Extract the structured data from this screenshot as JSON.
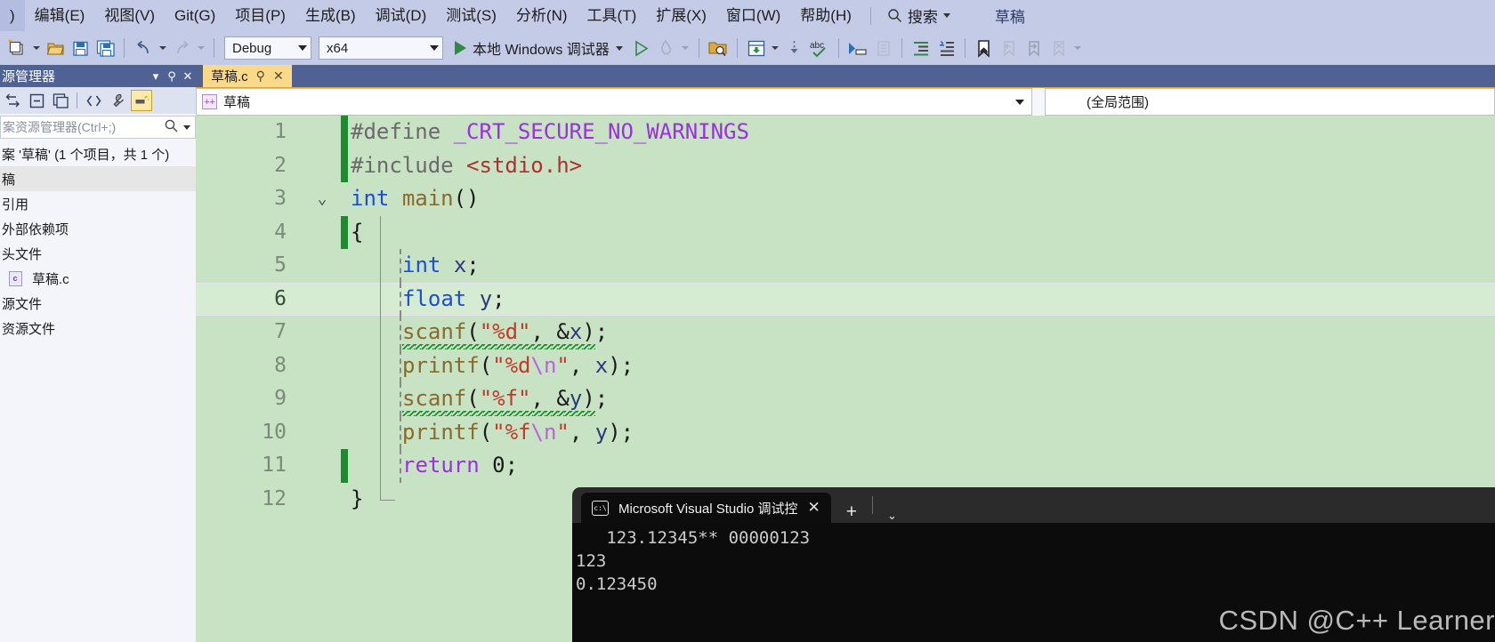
{
  "menu": {
    "items": [
      {
        "label": ")",
        "name": "menu-file-partial"
      },
      {
        "label": "编辑(E)",
        "name": "menu-edit"
      },
      {
        "label": "视图(V)",
        "name": "menu-view"
      },
      {
        "label": "Git(G)",
        "name": "menu-git"
      },
      {
        "label": "项目(P)",
        "name": "menu-project"
      },
      {
        "label": "生成(B)",
        "name": "menu-build"
      },
      {
        "label": "调试(D)",
        "name": "menu-debug"
      },
      {
        "label": "测试(S)",
        "name": "menu-test"
      },
      {
        "label": "分析(N)",
        "name": "menu-analyze"
      },
      {
        "label": "工具(T)",
        "name": "menu-tools"
      },
      {
        "label": "扩展(X)",
        "name": "menu-extensions"
      },
      {
        "label": "窗口(W)",
        "name": "menu-window"
      },
      {
        "label": "帮助(H)",
        "name": "menu-help"
      }
    ],
    "search_label": "搜索",
    "project_name": "草稿"
  },
  "toolbar": {
    "config": "Debug",
    "platform": "x64",
    "run_label": "本地 Windows 调试器",
    "icons": [
      "new-project-icon",
      "open-file-icon",
      "save-icon",
      "save-all-icon",
      "undo-icon",
      "redo-icon",
      "attach-process-icon",
      "step-into-icon",
      "spell-check-icon",
      "comment-icon",
      "uncomment-icon",
      "indent-icon",
      "outdent-icon",
      "bookmark-icon",
      "prev-bookmark-icon",
      "next-bookmark-icon",
      "clear-bookmarks-icon"
    ]
  },
  "solution_explorer": {
    "title": "源管理器",
    "search_placeholder": "案资源管理器(Ctrl+;)",
    "toolbar_icons": [
      "back-forward-icon",
      "collapse-all-icon",
      "show-all-files-icon",
      "code-view-icon",
      "properties-icon",
      "preview-icon"
    ],
    "tree": [
      {
        "label": "案 '草稿' (1 个项目，共 1 个)",
        "indent": 0,
        "icon": "",
        "selected": false,
        "name": "solution-node"
      },
      {
        "label": "稿",
        "indent": 1,
        "icon": "",
        "selected": true,
        "name": "project-node"
      },
      {
        "label": "引用",
        "indent": 2,
        "icon": "",
        "selected": false,
        "name": "references-node"
      },
      {
        "label": "外部依赖项",
        "indent": 2,
        "icon": "",
        "selected": false,
        "name": "external-dependencies-node"
      },
      {
        "label": "头文件",
        "indent": 2,
        "icon": "",
        "selected": false,
        "name": "header-files-node"
      },
      {
        "label": "草稿.c",
        "indent": 3,
        "icon": "c-file-icon",
        "selected": false,
        "name": "source-file-node"
      },
      {
        "label": "源文件",
        "indent": 2,
        "icon": "",
        "selected": false,
        "name": "source-files-node"
      },
      {
        "label": "资源文件",
        "indent": 2,
        "icon": "",
        "selected": false,
        "name": "resource-files-node"
      }
    ]
  },
  "editor": {
    "tab_label": "草稿.c",
    "nav_left": "草稿",
    "nav_right": "(全局范围)",
    "lines": [
      {
        "num": "1",
        "change": true,
        "fold": "",
        "guide": "none"
      },
      {
        "num": "2",
        "change": true,
        "fold": "",
        "guide": "none"
      },
      {
        "num": "3",
        "change": false,
        "fold": "v",
        "guide": "none"
      },
      {
        "num": "4",
        "change": true,
        "fold": "",
        "guide": "brace"
      },
      {
        "num": "5",
        "change": false,
        "fold": "",
        "guide": "both"
      },
      {
        "num": "6",
        "change": false,
        "fold": "",
        "guide": "both",
        "highlight": true
      },
      {
        "num": "7",
        "change": false,
        "fold": "",
        "guide": "both"
      },
      {
        "num": "8",
        "change": false,
        "fold": "",
        "guide": "both"
      },
      {
        "num": "9",
        "change": false,
        "fold": "",
        "guide": "both"
      },
      {
        "num": "10",
        "change": false,
        "fold": "",
        "guide": "both"
      },
      {
        "num": "11",
        "change": true,
        "fold": "",
        "guide": "both"
      },
      {
        "num": "12",
        "change": false,
        "fold": "",
        "guide": "brace-end"
      }
    ],
    "code": [
      "#define _CRT_SECURE_NO_WARNINGS",
      "#include <stdio.h>",
      "int main()",
      "{",
      "    int x;",
      "    float y;",
      "    scanf(\"%d\", &x);",
      "    printf(\"%d\\n\", x);",
      "    scanf(\"%f\", &y);",
      "    printf(\"%f\\n\", y);",
      "    return 0;",
      "}"
    ]
  },
  "terminal": {
    "tab_label": "Microsoft Visual Studio 调试控",
    "new_tab_label": "+",
    "output": "   123.12345** 00000123\n123\n0.123450"
  },
  "watermark": "CSDN @C++ Learner",
  "colors": {
    "menu_bg": "#c3cbe6",
    "accent_tab": "#fbd98b",
    "editor_bg": "#c8e2c4",
    "panel_header": "#4f6293",
    "terminal_bg": "#0c0c0c"
  }
}
